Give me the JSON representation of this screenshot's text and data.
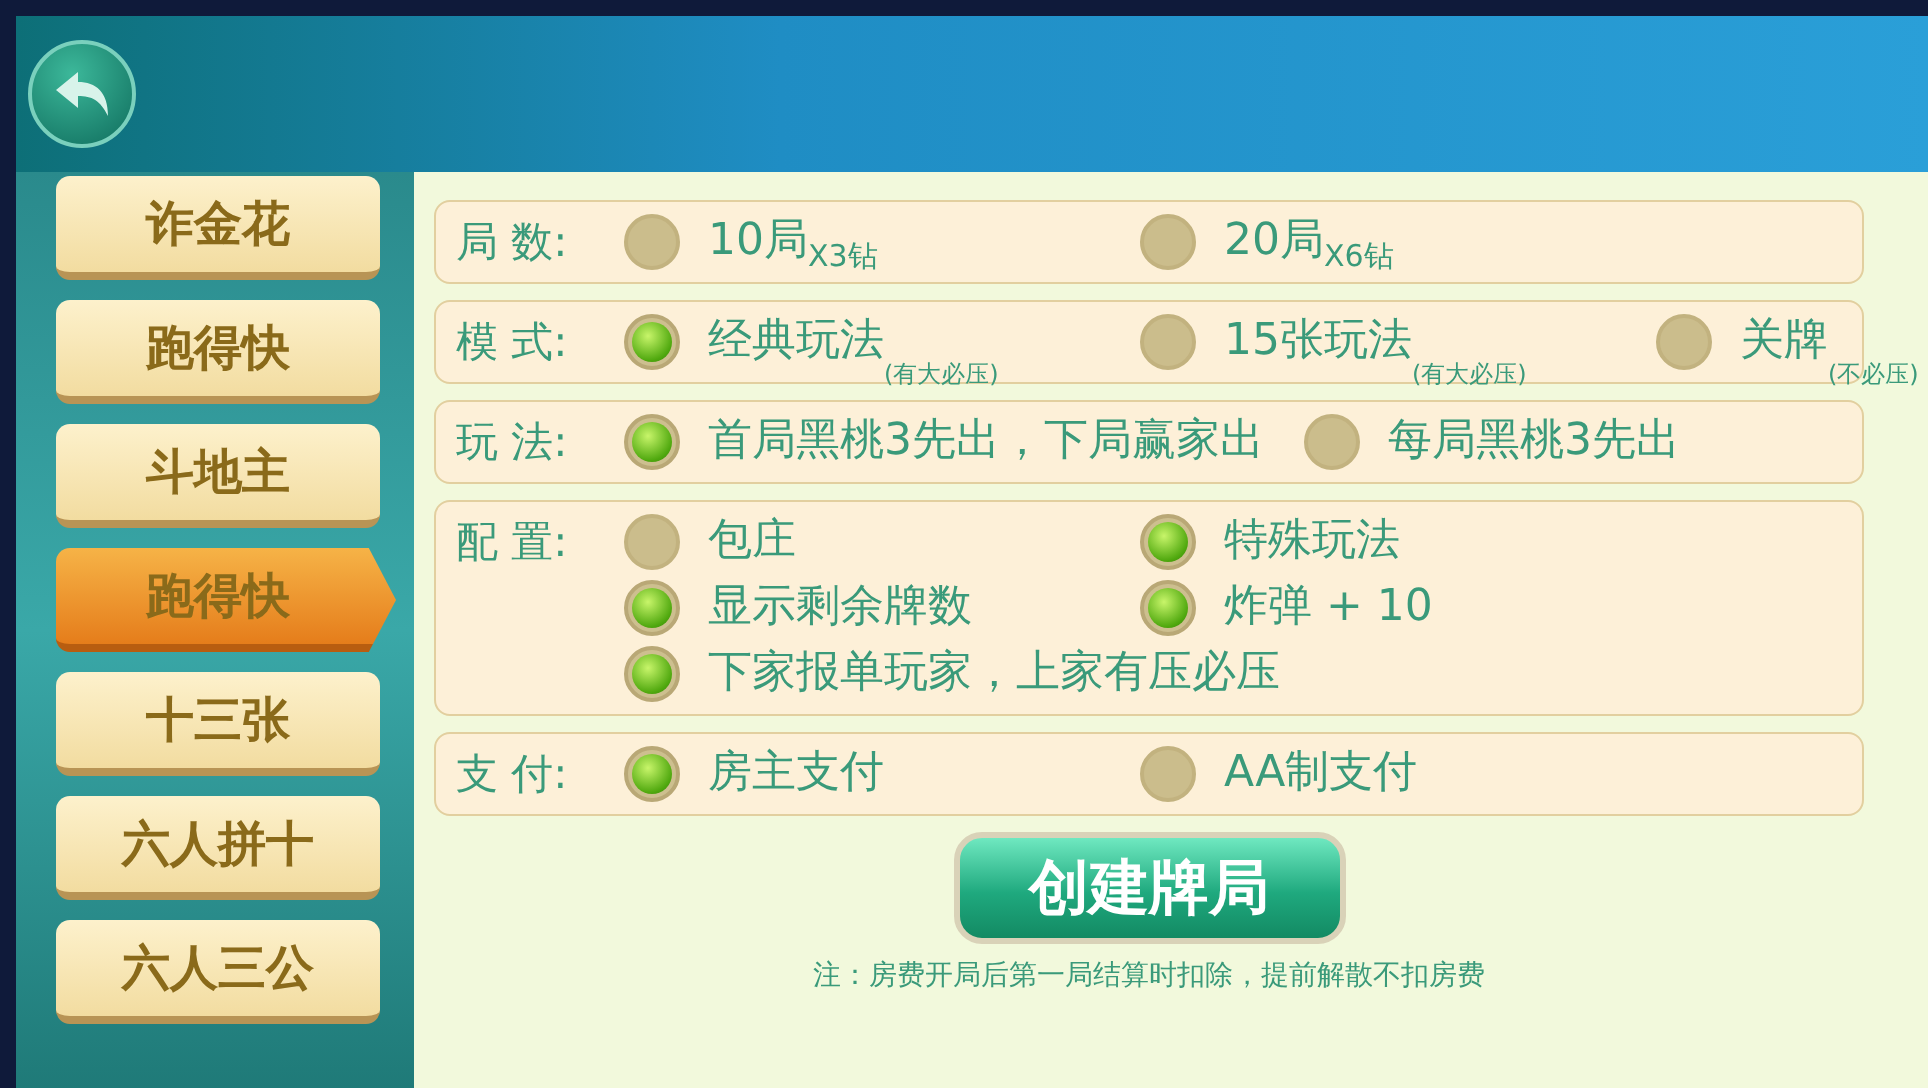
{
  "sidebar": {
    "items": [
      {
        "label": "诈金花",
        "selected": false
      },
      {
        "label": "跑得快",
        "selected": false
      },
      {
        "label": "斗地主",
        "selected": false
      },
      {
        "label": "跑得快",
        "selected": true
      },
      {
        "label": "十三张",
        "selected": false
      },
      {
        "label": "六人拼十",
        "selected": false
      },
      {
        "label": "六人三公",
        "selected": false
      }
    ]
  },
  "sections": [
    {
      "label": "局 数:",
      "lines": [
        [
          {
            "text": "10局",
            "sub": "X3钻",
            "selected": false
          },
          {
            "text": "20局",
            "sub": "X6钻",
            "selected": false
          }
        ]
      ]
    },
    {
      "label": "模 式:",
      "lines": [
        [
          {
            "text": "经典玩法",
            "note": "(有大必压)",
            "selected": true
          },
          {
            "text": "15张玩法",
            "note": "(有大必压)",
            "selected": false
          },
          {
            "text": "关牌",
            "note": "(不必压)",
            "selected": false
          }
        ]
      ]
    },
    {
      "label": "玩 法:",
      "lines": [
        [
          {
            "text": "首局黑桃3先出，下局赢家出",
            "selected": true
          },
          {
            "text": "每局黑桃3先出",
            "selected": false
          }
        ]
      ]
    },
    {
      "label": "配 置:",
      "lines": [
        [
          {
            "text": "包庄",
            "selected": false
          },
          {
            "text": "特殊玩法",
            "selected": true
          }
        ],
        [
          {
            "text": "显示剩余牌数",
            "selected": true
          },
          {
            "text": "炸弹 + 10",
            "selected": true
          }
        ],
        [
          {
            "text": "下家报单玩家，上家有压必压",
            "selected": true
          }
        ]
      ]
    },
    {
      "label": "支 付:",
      "lines": [
        [
          {
            "text": "房主支付",
            "selected": true
          },
          {
            "text": "AA制支付",
            "selected": false
          }
        ]
      ]
    }
  ],
  "create_button": "创建牌局",
  "note": "注：房费开局后第一局结算时扣除，提前解散不扣房费"
}
